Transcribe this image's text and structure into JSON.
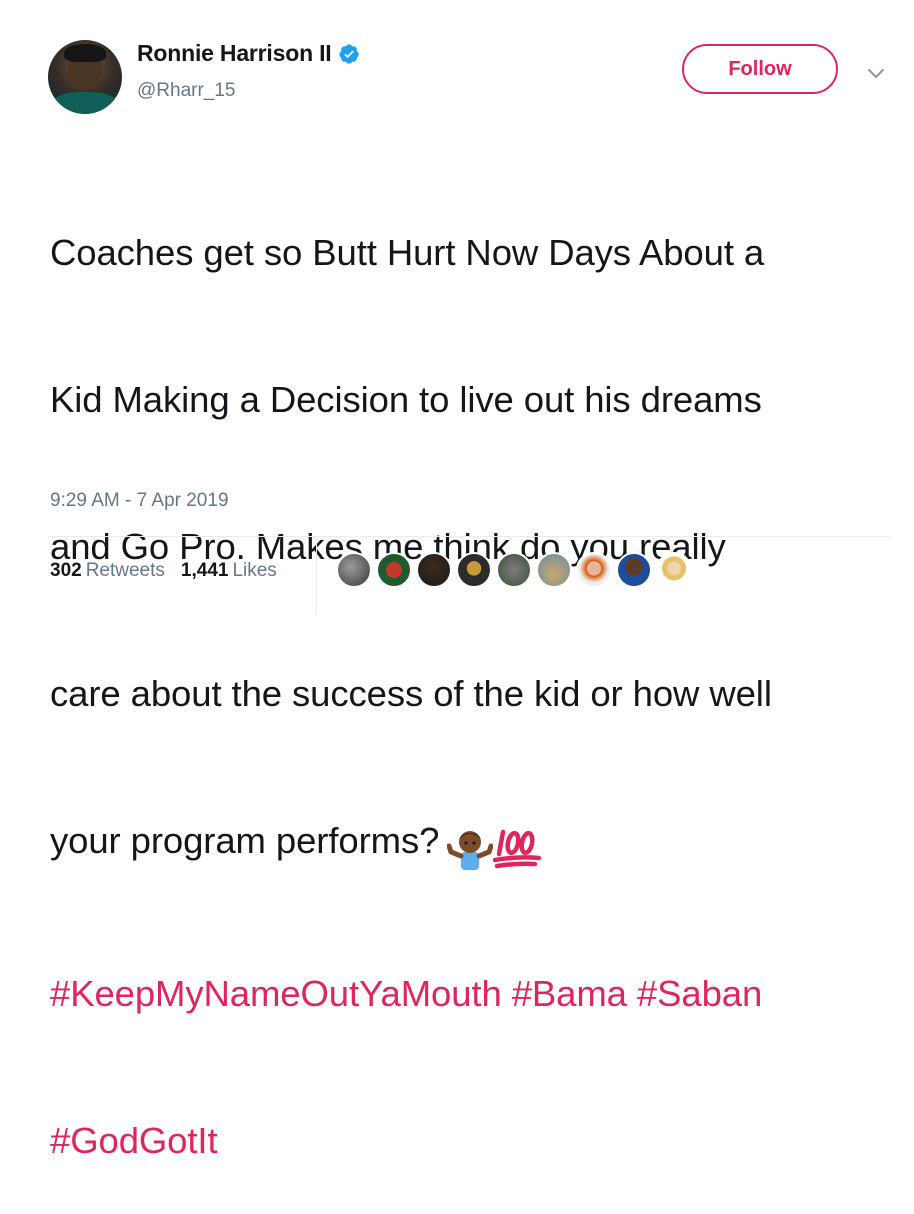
{
  "user": {
    "name": "Ronnie Harrison II",
    "handle": "@Rharr_15",
    "verified": true
  },
  "follow_label": "Follow",
  "tweet": {
    "lines": [
      "Coaches get so Butt Hurt Now Days About a",
      "Kid Making a Decision to live out his dreams",
      "and Go Pro. Makes me think do you really",
      "care about the success of the kid or how well",
      "your program performs?"
    ],
    "emojis": [
      "person-shrugging-icon",
      "hundred-points-icon"
    ],
    "hashtags": [
      "#KeepMyNameOutYaMouth",
      "#Bama",
      "#Saban",
      "#GodGotIt"
    ]
  },
  "timestamp": "9:29 AM - 7 Apr 2019",
  "stats": {
    "retweets_count": "302",
    "retweets_label": "Retweets",
    "likes_count": "1,441",
    "likes_label": "Likes"
  },
  "likers_count_shown": 9,
  "colors": {
    "accent": "#e0245e",
    "secondary_text": "#657786",
    "verified": "#1da1f2",
    "border": "#e6ecf0"
  }
}
